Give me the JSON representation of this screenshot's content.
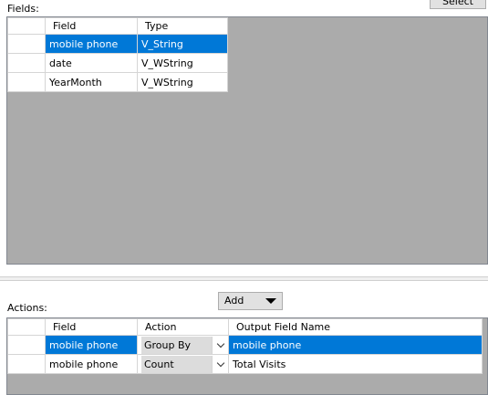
{
  "header": {
    "select_label": "Select"
  },
  "fields": {
    "label": "Fields:",
    "columns": [
      "Field",
      "Type"
    ],
    "rows": [
      {
        "field": "mobile phone",
        "type": "V_String",
        "selected": true
      },
      {
        "field": "date",
        "type": "V_WString",
        "selected": false
      },
      {
        "field": "YearMonth",
        "type": "V_WString",
        "selected": false
      }
    ]
  },
  "actions": {
    "label": "Actions:",
    "add_label": "Add",
    "columns": [
      "Field",
      "Action",
      "Output Field Name"
    ],
    "rows": [
      {
        "field": "mobile phone",
        "action": "Group By",
        "output": "mobile phone",
        "selected": true
      },
      {
        "field": "mobile phone",
        "action": "Count",
        "output": "Total Visits",
        "selected": false
      }
    ]
  },
  "colors": {
    "selection": "#0078d7",
    "grid_background": "#ababab"
  },
  "icons": [
    "row-pointer-icon",
    "dropdown-caret-icon",
    "chevron-down-icon"
  ]
}
